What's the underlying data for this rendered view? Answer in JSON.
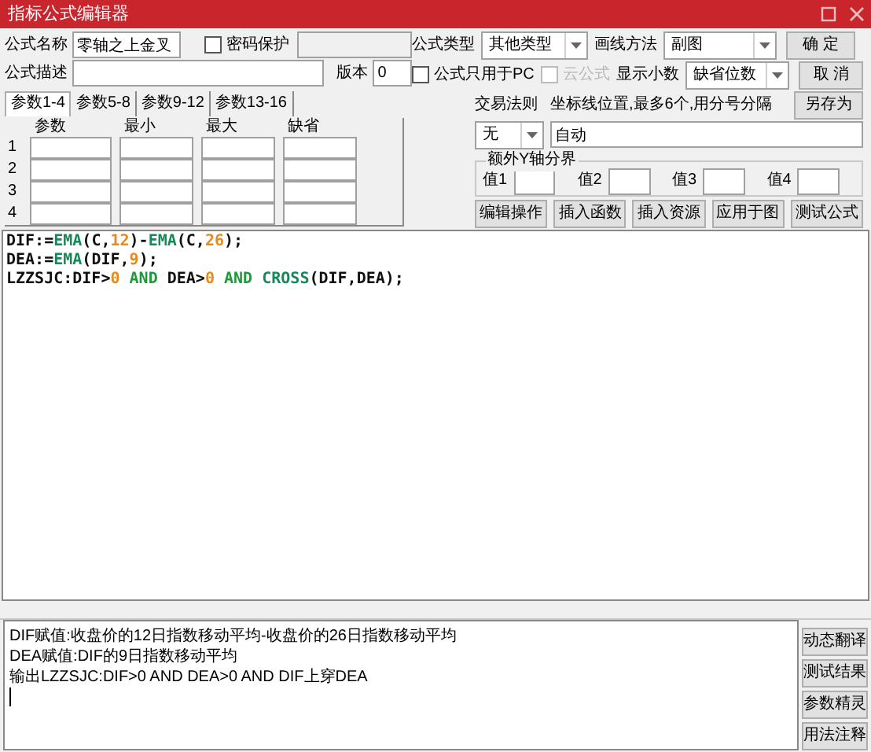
{
  "window": {
    "title": "指标公式编辑器"
  },
  "formula_name": {
    "label": "公式名称",
    "value": "零轴之上金叉"
  },
  "password": {
    "label": "密码保护",
    "checked": false
  },
  "description": {
    "label": "公式描述"
  },
  "version": {
    "label": "版本",
    "value": "0"
  },
  "param_tabs": [
    {
      "label": "参数1-4",
      "selected": true
    },
    {
      "label": "参数5-8",
      "selected": false
    },
    {
      "label": "参数9-12",
      "selected": false
    },
    {
      "label": "参数13-16",
      "selected": false
    }
  ],
  "param_table": {
    "columns": [
      "参数",
      "最小",
      "最大",
      "缺省"
    ],
    "rows": [
      "1",
      "2",
      "3",
      "4"
    ]
  },
  "formula_type": {
    "label": "公式类型",
    "value": "其他类型"
  },
  "draw_method": {
    "label": "画线方法",
    "value": "副图"
  },
  "pc_only": {
    "label": "公式只用于PC",
    "checked": false,
    "disabled": false
  },
  "cloud": {
    "label": "云公式",
    "checked": false,
    "disabled": true
  },
  "decimals": {
    "label": "显示小数",
    "value": "缺省位数"
  },
  "trade_rule": {
    "label": "交易法则",
    "value": "无"
  },
  "axis_lines": {
    "label": "坐标线位置,最多6个,用分号分隔",
    "value": "自动"
  },
  "extra_y": {
    "title": "额外Y轴分界",
    "fields": [
      "值1",
      "值2",
      "值3",
      "值4"
    ]
  },
  "side_buttons": [
    "确 定",
    "取 消",
    "另存为"
  ],
  "tool_buttons": [
    "编辑操作",
    "插入函数",
    "插入资源",
    "应用于图",
    "测试公式"
  ],
  "code": [
    [
      {
        "kind": "plain",
        "text": "DIF:="
      },
      {
        "kind": "func",
        "text": "EMA"
      },
      {
        "kind": "plain",
        "text": "(C,"
      },
      {
        "kind": "num",
        "text": "12"
      },
      {
        "kind": "plain",
        "text": ")-"
      },
      {
        "kind": "func",
        "text": "EMA"
      },
      {
        "kind": "plain",
        "text": "(C,"
      },
      {
        "kind": "num",
        "text": "26"
      },
      {
        "kind": "plain",
        "text": ");"
      }
    ],
    [
      {
        "kind": "plain",
        "text": "DEA:="
      },
      {
        "kind": "func",
        "text": "EMA"
      },
      {
        "kind": "plain",
        "text": "(DIF,"
      },
      {
        "kind": "num",
        "text": "9"
      },
      {
        "kind": "plain",
        "text": ");"
      }
    ],
    [
      {
        "kind": "plain",
        "text": "LZZSJC:DIF>"
      },
      {
        "kind": "num",
        "text": "0"
      },
      {
        "kind": "keyword",
        "text": " AND "
      },
      {
        "kind": "plain",
        "text": "DEA>"
      },
      {
        "kind": "num",
        "text": "0"
      },
      {
        "kind": "keyword",
        "text": " AND "
      },
      {
        "kind": "func",
        "text": "CROSS"
      },
      {
        "kind": "plain",
        "text": "(DIF,DEA);"
      }
    ]
  ],
  "explanation": [
    "DIF赋值:收盘价的12日指数移动平均-收盘价的26日指数移动平均",
    "DEA赋值:DIF的9日指数移动平均",
    "输出LZZSJC:DIF>0 AND DEA>0 AND DIF上穿DEA"
  ],
  "bottom_buttons": [
    "动态翻译",
    "测试结果",
    "参数精灵",
    "用法注释"
  ]
}
